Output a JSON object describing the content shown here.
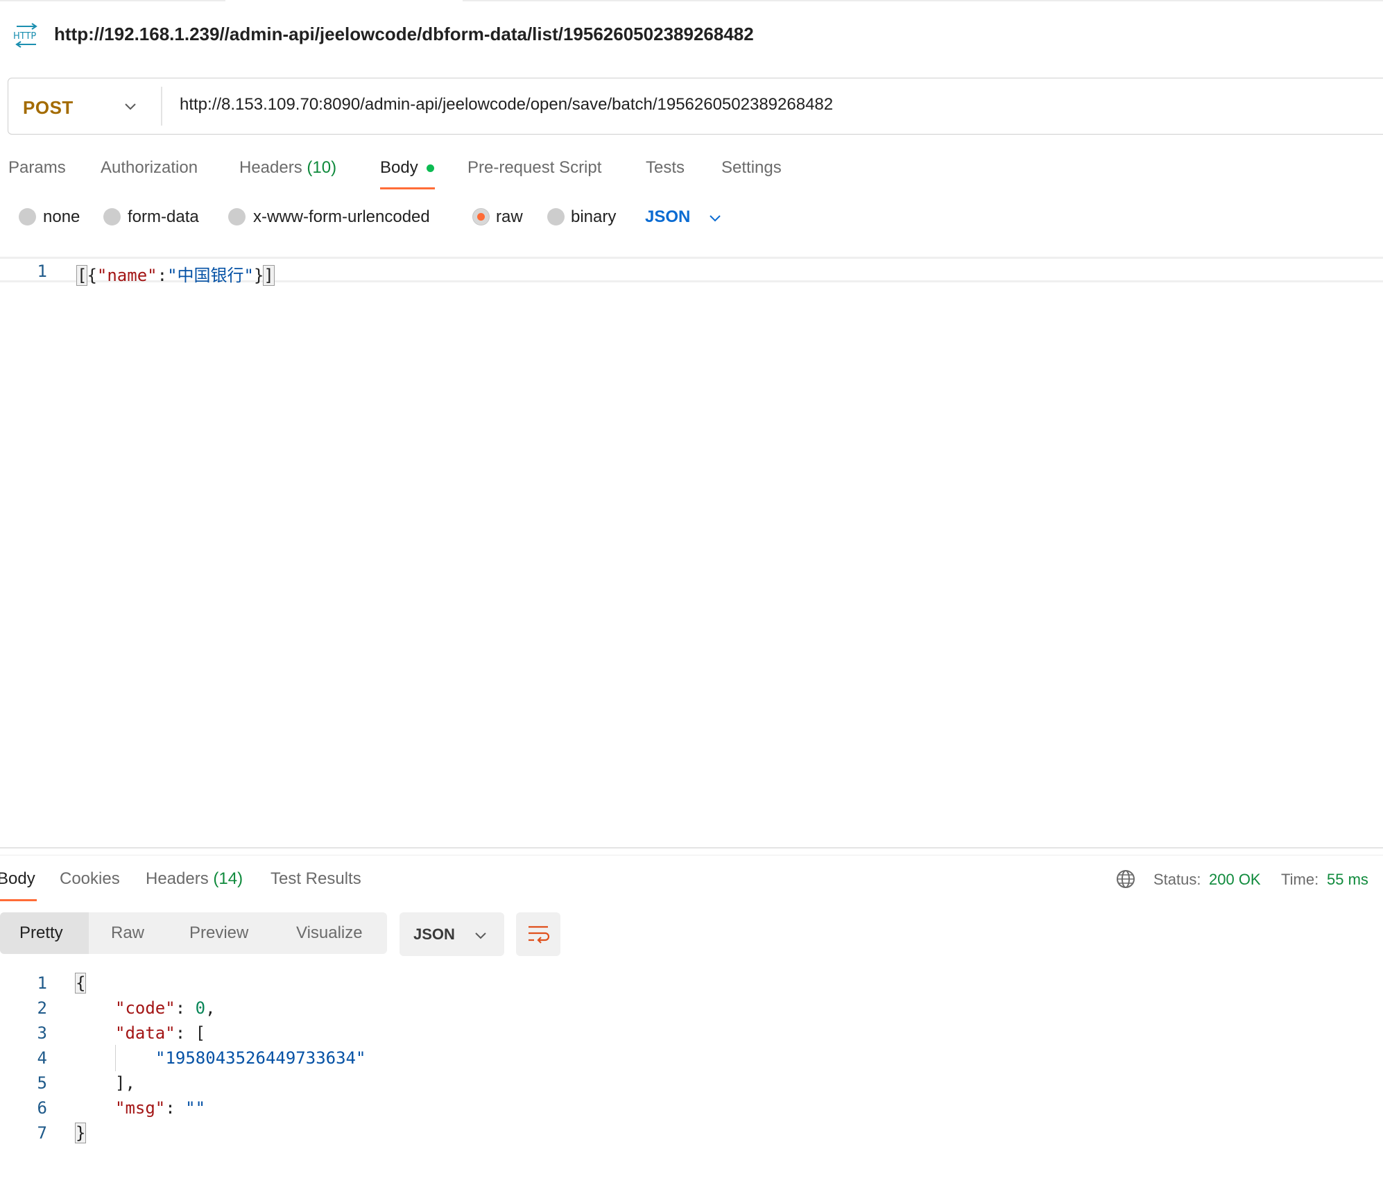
{
  "request": {
    "title": "http://192.168.1.239//admin-api/jeelowcode/dbform-data/list/1956260502389268482",
    "method": "POST",
    "url": "http://8.153.109.70:8090/admin-api/jeelowcode/open/save/batch/1956260502389268482",
    "icon": "http-request-icon"
  },
  "request_tabs": {
    "params": "Params",
    "authorization": "Authorization",
    "headers": "Headers",
    "headers_count": "(10)",
    "body": "Body",
    "pre_request": "Pre-request Script",
    "tests": "Tests",
    "settings": "Settings",
    "active": "Body"
  },
  "body_types": {
    "none": "none",
    "form_data": "form-data",
    "urlencoded": "x-www-form-urlencoded",
    "raw": "raw",
    "binary": "binary",
    "selected": "raw",
    "language": "JSON"
  },
  "request_body": {
    "line_number": "1",
    "open_bracket": "[",
    "open_brace": "{",
    "key": "\"name\"",
    "colon": ":",
    "value": "\"中国银行\"",
    "close_brace": "}",
    "close_bracket": "]"
  },
  "response_tabs": {
    "body": "Body",
    "cookies": "Cookies",
    "headers": "Headers",
    "headers_count": "(14)",
    "test_results": "Test Results",
    "active": "Body"
  },
  "response_meta": {
    "status_label": "Status:",
    "status_value": "200 OK",
    "time_label": "Time:",
    "time_value": "55 ms"
  },
  "view_modes": {
    "pretty": "Pretty",
    "raw": "Raw",
    "preview": "Preview",
    "visualize": "Visualize",
    "active": "Pretty",
    "format": "JSON"
  },
  "response_body": {
    "line_numbers": [
      "1",
      "2",
      "3",
      "4",
      "5",
      "6",
      "7"
    ],
    "open_brace": "{",
    "code_key": "\"code\"",
    "code_value": "0",
    "data_key": "\"data\"",
    "data_open": "[",
    "data_item": "\"1958043526449733634\"",
    "data_close": "],",
    "msg_key": "\"msg\"",
    "msg_value": "\"\"",
    "close_brace": "}"
  },
  "colors": {
    "accent": "#ff6c37",
    "method": "#a36b00",
    "success": "#0f8a3c",
    "link_blue": "#0a6bd2",
    "json_key": "#a31515",
    "json_string": "#0451a5",
    "json_number": "#098658"
  }
}
